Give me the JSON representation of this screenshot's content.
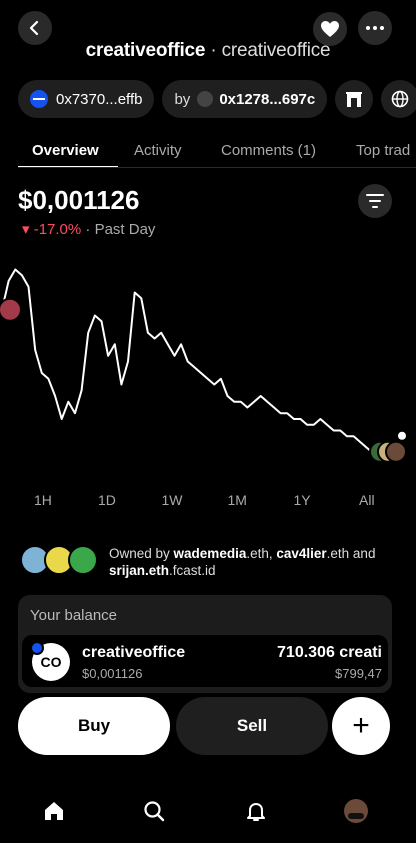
{
  "header": {
    "name_bold": "creativeoffice",
    "separator": " · ",
    "name_light": "creativeoffice"
  },
  "chips": {
    "contract": "0x7370...effb",
    "creator_prefix": "by",
    "creator_addr": "0x1278...697c"
  },
  "tabs": [
    {
      "label": "Overview",
      "active": true
    },
    {
      "label": "Activity",
      "active": false
    },
    {
      "label": "Comments (1)",
      "active": false
    },
    {
      "label": "Top trad",
      "active": false
    }
  ],
  "price": {
    "value": "$0,001126",
    "change": "▾ -17.0%",
    "period": " · Past Day"
  },
  "ranges": [
    "1H",
    "1D",
    "1W",
    "1M",
    "1Y",
    "All"
  ],
  "owners": {
    "prefix": "Owned by ",
    "owner1": "wademedia",
    "owner1_suffix": ".eth, ",
    "owner2": "cav4lier",
    "owner2_suffix": ".eth and",
    "owner3": "srijan.eth",
    "owner3_suffix": ".fcast.id"
  },
  "balance": {
    "label": "Your balance",
    "token_logo_text": "CO",
    "token_name": "creativeoffice",
    "token_price": "$0,001126",
    "amount": "710.306 creati",
    "value": "$799,47"
  },
  "actions": {
    "buy": "Buy",
    "sell": "Sell",
    "plus": "+"
  },
  "chart_data": {
    "type": "line",
    "title": "",
    "x": [
      0,
      1,
      2,
      3,
      4,
      5,
      6,
      7,
      8,
      9,
      10,
      11,
      12,
      13,
      14,
      15,
      16,
      17,
      18,
      19,
      20,
      21,
      22,
      23,
      24,
      25,
      26,
      27,
      28,
      29,
      30,
      31,
      32,
      33,
      34,
      35,
      36,
      37,
      38,
      39,
      40,
      41,
      42,
      43,
      44,
      45,
      46,
      47,
      48,
      49,
      50,
      51,
      52,
      53,
      54,
      55,
      56,
      57,
      58,
      59,
      60
    ],
    "values": [
      0.00137,
      0.00142,
      0.00144,
      0.00143,
      0.00141,
      0.0013,
      0.00126,
      0.00125,
      0.00122,
      0.00118,
      0.00121,
      0.00119,
      0.00123,
      0.00133,
      0.00136,
      0.00135,
      0.00129,
      0.00131,
      0.00124,
      0.00128,
      0.0014,
      0.00139,
      0.00133,
      0.00132,
      0.00133,
      0.00131,
      0.00129,
      0.00131,
      0.00128,
      0.00127,
      0.00126,
      0.00125,
      0.00124,
      0.00125,
      0.00122,
      0.00121,
      0.00121,
      0.0012,
      0.00121,
      0.00122,
      0.00121,
      0.0012,
      0.00119,
      0.00119,
      0.00118,
      0.00118,
      0.00117,
      0.00117,
      0.00118,
      0.00117,
      0.00116,
      0.00116,
      0.00115,
      0.00115,
      0.00114,
      0.00113,
      0.00112,
      0.00112,
      0.00112,
      0.00113,
      0.00113
    ],
    "ylim": [
      0.0011,
      0.00146
    ],
    "grid": false,
    "line_color": "#ffffff",
    "time_ranges": [
      "1H",
      "1D",
      "1W",
      "1M",
      "1Y",
      "All"
    ]
  }
}
